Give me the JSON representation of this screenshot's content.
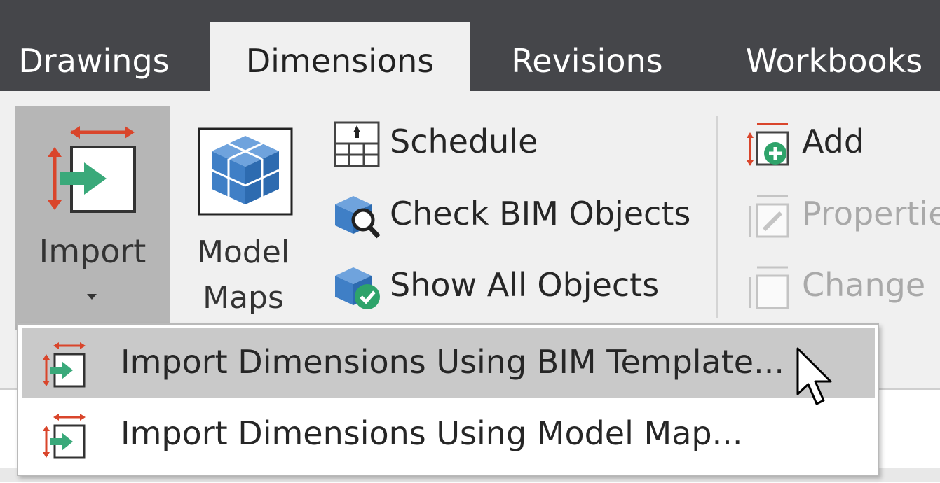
{
  "tabs": [
    {
      "label": "Drawings",
      "active": false
    },
    {
      "label": "Dimensions",
      "active": true
    },
    {
      "label": "Revisions",
      "active": false
    },
    {
      "label": "Workbooks",
      "active": false
    }
  ],
  "ribbon": {
    "import": {
      "label": "Import",
      "icon": "import-dimensions-icon"
    },
    "model_maps": {
      "line1": "Model",
      "line2": "Maps",
      "icon": "model-maps-cube-icon"
    },
    "schedule": {
      "label": "Schedule",
      "icon": "schedule-table-icon"
    },
    "check_bim": {
      "label": "Check BIM Objects",
      "icon": "check-bim-objects-icon"
    },
    "show_all": {
      "label": "Show All Objects",
      "icon": "show-all-objects-icon"
    },
    "add": {
      "label": "Add",
      "icon": "add-dimension-icon"
    },
    "properties": {
      "label": "Properties",
      "icon": "dimension-properties-icon",
      "disabled": true
    },
    "change": {
      "label": "Change",
      "icon": "change-dimension-icon",
      "disabled": true
    }
  },
  "menu": {
    "items": [
      {
        "label": "Import Dimensions Using BIM Template...",
        "icon": "import-dimensions-icon",
        "highlighted": true
      },
      {
        "label": "Import Dimensions Using Model Map...",
        "icon": "import-dimensions-icon",
        "highlighted": false
      }
    ]
  },
  "colors": {
    "tabbar": "#45464a",
    "ribbon": "#f0f0f0",
    "import_pressed": "#b6b6b6",
    "menu_highlight": "#c9c9c9",
    "dimension_red": "#d9452b",
    "arrow_green": "#3aa97a",
    "cube_blue": "#3f7fc6"
  }
}
